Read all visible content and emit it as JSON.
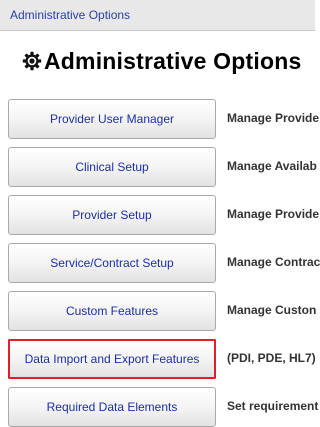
{
  "header": {
    "title": "Administrative Options"
  },
  "page": {
    "title": "Administrative Options",
    "title_icon": "gear-icon"
  },
  "options": [
    {
      "button_label": "Provider User Manager",
      "description": "Manage Provide"
    },
    {
      "button_label": "Clinical Setup",
      "description": "Manage Availab"
    },
    {
      "button_label": "Provider Setup",
      "description": "Manage Provide"
    },
    {
      "button_label": "Service/Contract Setup",
      "description": "Manage Contrac"
    },
    {
      "button_label": "Custom Features",
      "description": "Manage Custon"
    },
    {
      "button_label": "Data Import and Export Features",
      "description": "(PDI, PDE, HL7)",
      "highlighted": true,
      "highlight_color": "#e01f26"
    },
    {
      "button_label": "Required Data Elements",
      "description": "Set requirement"
    }
  ],
  "colors": {
    "link_blue": "#1b2fa8",
    "header_bg": "#e8e8e8",
    "highlight": "#e01f26"
  }
}
